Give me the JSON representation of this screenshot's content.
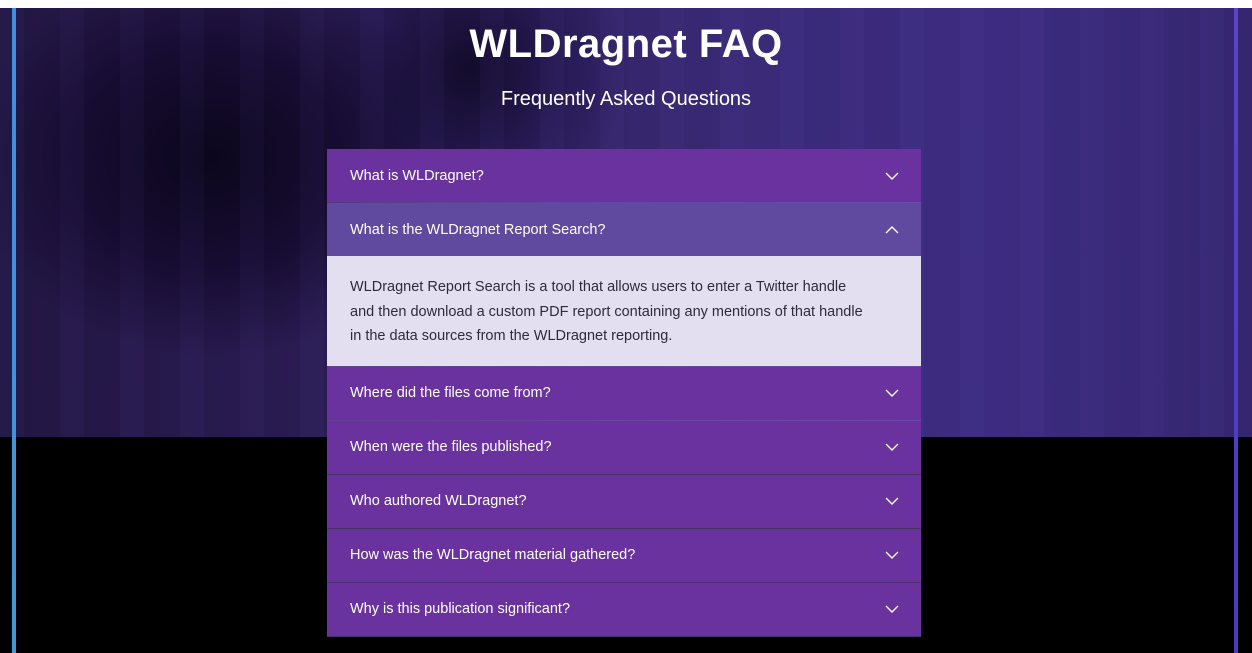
{
  "header": {
    "title": "WLDragnet FAQ",
    "subtitle": "Frequently Asked Questions"
  },
  "faq": {
    "items": [
      {
        "question": "What is WLDragnet?",
        "open": false,
        "icon": "chevron-down-icon"
      },
      {
        "question": "What is the WLDragnet Report Search?",
        "open": true,
        "icon": "chevron-up-icon",
        "answer": "WLDragnet Report Search is a tool that allows users to enter a Twitter handle and then download a custom PDF report containing any mentions of that handle in the data sources from the WLDragnet reporting."
      },
      {
        "question": "Where did the files come from?",
        "open": false,
        "icon": "chevron-down-icon"
      },
      {
        "question": "When were the files published?",
        "open": false,
        "icon": "chevron-down-icon"
      },
      {
        "question": "Who authored WLDragnet?",
        "open": false,
        "icon": "chevron-down-icon"
      },
      {
        "question": "How was the WLDragnet material gathered?",
        "open": false,
        "icon": "chevron-down-icon"
      },
      {
        "question": "Why is this publication significant?",
        "open": false,
        "icon": "chevron-down-icon"
      }
    ]
  },
  "colors": {
    "question_bg": "#6a329e",
    "question_open_bg": "#5f4a9f",
    "answer_bg": "#e4dff0",
    "left_accent": "#3d8fe0",
    "right_accent": "#5b42c9"
  }
}
